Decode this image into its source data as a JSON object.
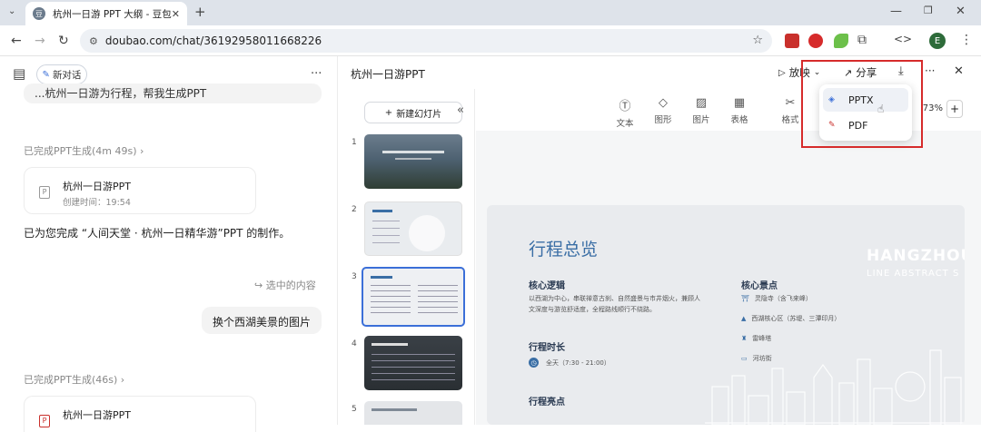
{
  "browser": {
    "tab_title": "杭州一日游 PPT 大纲 - 豆包",
    "tab_close": "✕",
    "new_tab": "+",
    "url": "doubao.com/chat/36192958011668226",
    "profile_initial": "E",
    "window_min": "—",
    "window_restore": "❐",
    "window_close": "✕"
  },
  "left": {
    "new_chat_label": "新对话",
    "more": "···",
    "cut_text": "...杭州一日游为行程，帮我生成PPT",
    "ppt1_status": "已完成PPT生成(4m 49s)",
    "ppt1_title": "杭州一日游PPT",
    "ppt1_time": "创建时间：19:54",
    "response_text": "已为您完成 “人间天堂 · 杭州一日精华游”PPT 的制作。",
    "selected_content": "选中的内容",
    "user_msg": "换个西湖美景的图片",
    "ppt2_status": "已完成PPT生成(46s)",
    "ppt2_title": "杭州一日游PPT"
  },
  "right": {
    "title": "杭州一日游PPT",
    "play_label": "放映",
    "share_label": "分享",
    "more": "···",
    "close": "✕",
    "new_slide_label": "新建幻灯片",
    "collapse": "«",
    "tools": [
      "文本",
      "图形",
      "图片",
      "表格",
      "格式"
    ],
    "zoom": "73%",
    "zoom_plus": "+",
    "slide_numbers": [
      "1",
      "2",
      "3",
      "4",
      "5"
    ]
  },
  "slide": {
    "title": "行程总览",
    "watermark1": "HANGZHOU C",
    "watermark2": "LINE ABSTRACT S",
    "logic_heading": "核心逻辑",
    "logic_text1": "以西湖为中心，串联禅意古刹、自然盛景与市井烟火，兼顾人",
    "logic_text2": "文深度与游览舒适度，全程路线顺行不绕路。",
    "spots_heading": "核心景点",
    "spots": [
      "灵隐寺（含飞来峰）",
      "西湖核心区（苏堤、三潭印月）",
      "雷峰塔",
      "河坊街"
    ],
    "duration_heading": "行程时长",
    "duration_text": "全天（7:30 - 21:00）",
    "highlights_heading": "行程亮点"
  },
  "dropdown": {
    "pptx_label": "PPTX",
    "pdf_label": "PDF"
  },
  "colors": {
    "highlight_box": "#d62b2b",
    "tab_bar": "#dee3ea",
    "slide_title": "#3a6ea5",
    "selected_thumb": "#3b6fd8"
  }
}
